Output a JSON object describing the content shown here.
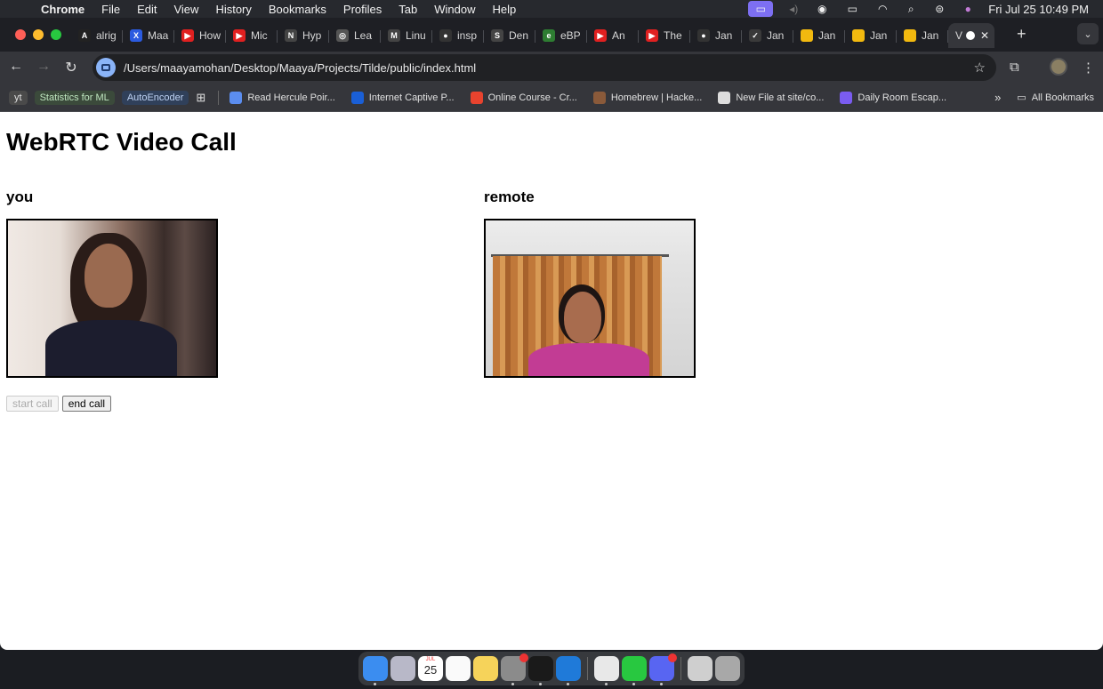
{
  "menubar": {
    "app": "Chrome",
    "items": [
      "File",
      "Edit",
      "View",
      "History",
      "Bookmarks",
      "Profiles",
      "Tab",
      "Window",
      "Help"
    ],
    "clock": "Fri Jul 25  10:49 PM"
  },
  "tabs": [
    {
      "label": "alrig",
      "color": "#222",
      "glyph": "A"
    },
    {
      "label": "Maa",
      "color": "#2b5be0",
      "glyph": "X"
    },
    {
      "label": "How",
      "color": "#e02020",
      "glyph": "▶"
    },
    {
      "label": "Mic",
      "color": "#e02020",
      "glyph": "▶"
    },
    {
      "label": "Hyp",
      "color": "#444",
      "glyph": "N"
    },
    {
      "label": "Lea",
      "color": "#555",
      "glyph": "◎"
    },
    {
      "label": "Linu",
      "color": "#444",
      "glyph": "M"
    },
    {
      "label": "insp",
      "color": "#333",
      "glyph": "●"
    },
    {
      "label": "Den",
      "color": "#444",
      "glyph": "S"
    },
    {
      "label": "eBP",
      "color": "#2e7d32",
      "glyph": "e"
    },
    {
      "label": "An",
      "color": "#e02020",
      "glyph": "▶"
    },
    {
      "label": "The",
      "color": "#e02020",
      "glyph": "▶"
    },
    {
      "label": "Jan",
      "color": "#333",
      "glyph": "●"
    },
    {
      "label": "Jan",
      "color": "#3a3a3a",
      "glyph": "✓"
    },
    {
      "label": "Jan",
      "color": "#f2b90f",
      "glyph": ""
    },
    {
      "label": "Jan",
      "color": "#f2b90f",
      "glyph": ""
    },
    {
      "label": "Jan",
      "color": "#f2b90f",
      "glyph": ""
    }
  ],
  "active_tab": {
    "label": "V"
  },
  "toolbar": {
    "url": "/Users/maayamohan/Desktop/Maaya/Projects/Tilde/public/index.html"
  },
  "bookmarks": {
    "chips": [
      {
        "label": "yt",
        "style": "yt"
      },
      {
        "label": "Statistics for ML",
        "style": "green"
      },
      {
        "label": "AutoEncoder",
        "style": "blue"
      }
    ],
    "items": [
      {
        "label": "Read Hercule Poir...",
        "color": "#5b8def"
      },
      {
        "label": "Internet Captive P...",
        "color": "#1a5fd6"
      },
      {
        "label": "Online Course - Cr...",
        "color": "#e8432e"
      },
      {
        "label": "Homebrew | Hacke...",
        "color": "#8a5a3a"
      },
      {
        "label": "New File at site/co...",
        "color": "#ddd"
      },
      {
        "label": "Daily Room Escap...",
        "color": "#7a5cf0"
      }
    ],
    "more": "»",
    "all": "All Bookmarks"
  },
  "page": {
    "title": "WebRTC Video Call",
    "local_label": "you",
    "remote_label": "remote",
    "start_button": "start call",
    "end_button": "end call"
  },
  "dock": {
    "apps": [
      {
        "name": "finder",
        "color": "#3b8df0"
      },
      {
        "name": "launchpad",
        "color": "#b8b8c8"
      },
      {
        "name": "calendar",
        "color": "#ffffff"
      },
      {
        "name": "reminders",
        "color": "#fafafa"
      },
      {
        "name": "notes",
        "color": "#f6d35a"
      },
      {
        "name": "system-settings",
        "color": "#8b8b8b"
      },
      {
        "name": "terminal",
        "color": "#1a1a1a"
      },
      {
        "name": "vscode",
        "color": "#1f7ad9"
      },
      {
        "name": "chrome",
        "color": "#e8e8e8"
      },
      {
        "name": "whatsapp",
        "color": "#28c840"
      },
      {
        "name": "discord",
        "color": "#5865f2"
      },
      {
        "name": "preview",
        "color": "#cfcfcf"
      },
      {
        "name": "trash",
        "color": "#a8a8a8"
      }
    ],
    "calendar_day": "25",
    "calendar_month": "JUL"
  }
}
